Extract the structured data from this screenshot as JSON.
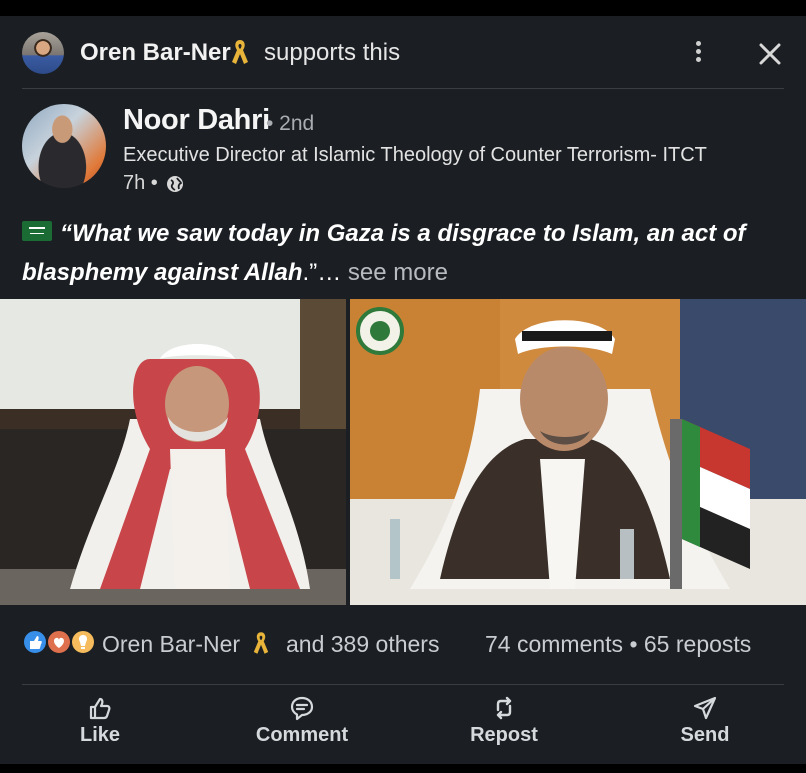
{
  "header": {
    "supporter_name": "Oren Bar-Ner",
    "supports_text": "supports this",
    "more_icon": "more-vertical-icon",
    "close_icon": "close-icon"
  },
  "author": {
    "name": "Noor Dahri",
    "degree": "• 2nd",
    "headline": "Executive Director at Islamic Theology of Counter Terrorism- ITCT",
    "time": "7h •",
    "visibility_icon": "globe-icon"
  },
  "post": {
    "quote": "“What we saw today in Gaza is a disgrace to Islam, an act of blasphemy against Allah",
    "quote_end": ".”",
    "ellipsis": "…",
    "see_more": "see more",
    "flag_icon": "saudi-flag-icon"
  },
  "social": {
    "reaction_icons": [
      "like-icon",
      "love-icon",
      "insightful-icon"
    ],
    "reaction_name": "Oren Bar-Ner",
    "reaction_others": "and 389 others",
    "counts": "74 comments • 65 reposts"
  },
  "actions": [
    {
      "label": "Like",
      "icon": "thumbs-up-icon"
    },
    {
      "label": "Comment",
      "icon": "comment-icon"
    },
    {
      "label": "Repost",
      "icon": "repost-icon"
    },
    {
      "label": "Send",
      "icon": "send-icon"
    }
  ],
  "colors": {
    "background": "#1b1f23",
    "ribbon": "#e8b43a",
    "text_primary": "#ffffff",
    "text_secondary": "#c9cdd1"
  }
}
